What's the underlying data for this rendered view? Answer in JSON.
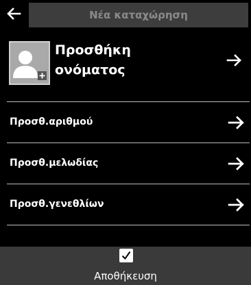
{
  "header": {
    "title": "Νέα καταχώρηση",
    "back_icon": "arrow-left-icon"
  },
  "name_entry": {
    "label_line1": "Προσθήκη",
    "label_line2": "ονόματος",
    "icon": "contact-avatar-add-icon"
  },
  "menu": {
    "items": [
      {
        "label": "Προσθ.αριθμού"
      },
      {
        "label": "Προσθ.μελωδίας"
      },
      {
        "label": "Προσθ.γενεθλίων"
      }
    ]
  },
  "footer": {
    "save_label": "Αποθήκευση",
    "save_icon": "checkmark-icon"
  },
  "colors": {
    "background": "#000000",
    "title_bar": "#3d3d3d",
    "footer_bar": "#3a3a3a",
    "avatar": "#a9a9a9"
  }
}
